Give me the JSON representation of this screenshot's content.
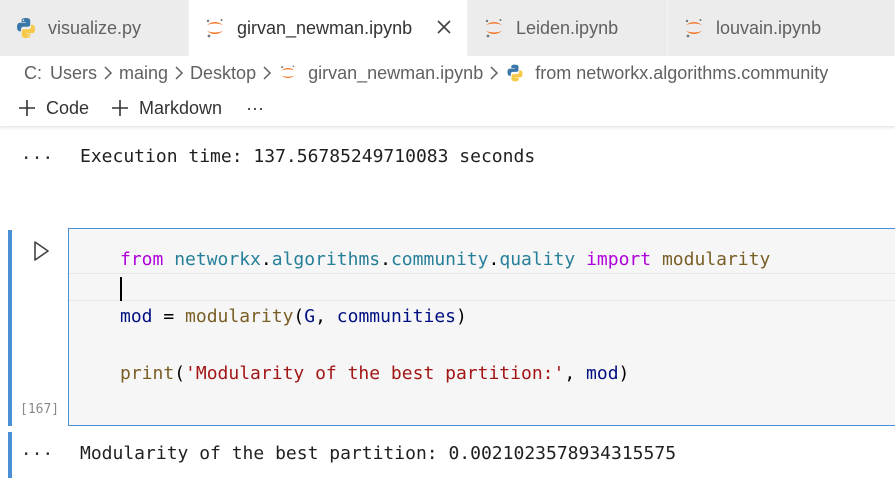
{
  "tabs": [
    {
      "label": "visualize.py",
      "icon": "python-icon"
    },
    {
      "label": "girvan_newman.ipynb",
      "icon": "jupyter-icon",
      "active": true
    },
    {
      "label": "Leiden.ipynb",
      "icon": "jupyter-icon"
    },
    {
      "label": "louvain.ipynb",
      "icon": "jupyter-icon"
    }
  ],
  "breadcrumb": [
    "C:",
    "Users",
    "maing",
    "Desktop",
    "girvan_newman.ipynb",
    "from networkx.algorithms.community"
  ],
  "toolbar": {
    "code_label": "Code",
    "markdown_label": "Markdown",
    "more_label": "···"
  },
  "cells": {
    "prev_output": {
      "dots": "···",
      "text": "Execution time: 137.56785249710083 seconds"
    },
    "code": {
      "execution_count": "[167]",
      "lines": [
        [
          {
            "t": "from",
            "c": "kw"
          },
          {
            "t": " ",
            "c": "op"
          },
          {
            "t": "networkx",
            "c": "mod"
          },
          {
            "t": ".",
            "c": "op"
          },
          {
            "t": "algorithms",
            "c": "mod"
          },
          {
            "t": ".",
            "c": "op"
          },
          {
            "t": "community",
            "c": "mod"
          },
          {
            "t": ".",
            "c": "op"
          },
          {
            "t": "quality",
            "c": "mod"
          },
          {
            "t": " ",
            "c": "op"
          },
          {
            "t": "import",
            "c": "kw"
          },
          {
            "t": " ",
            "c": "op"
          },
          {
            "t": "modularity",
            "c": "fn"
          }
        ],
        [],
        [
          {
            "t": "mod",
            "c": "var"
          },
          {
            "t": " = ",
            "c": "op"
          },
          {
            "t": "modularity",
            "c": "fn"
          },
          {
            "t": "(",
            "c": "op"
          },
          {
            "t": "G",
            "c": "var"
          },
          {
            "t": ", ",
            "c": "op"
          },
          {
            "t": "communities",
            "c": "var"
          },
          {
            "t": ")",
            "c": "op"
          }
        ],
        [],
        [
          {
            "t": "print",
            "c": "fn"
          },
          {
            "t": "(",
            "c": "op"
          },
          {
            "t": "'Modularity of the best partition:'",
            "c": "str"
          },
          {
            "t": ", ",
            "c": "op"
          },
          {
            "t": "mod",
            "c": "var"
          },
          {
            "t": ")",
            "c": "op"
          }
        ]
      ]
    },
    "output": {
      "dots": "···",
      "text": "Modularity of the best partition: 0.0021023578934315575"
    }
  },
  "colors": {
    "accent": "#4a90d9",
    "keyword": "#af00db",
    "module": "#267f99",
    "function": "#795e26",
    "variable": "#001080",
    "string": "#a31515"
  }
}
